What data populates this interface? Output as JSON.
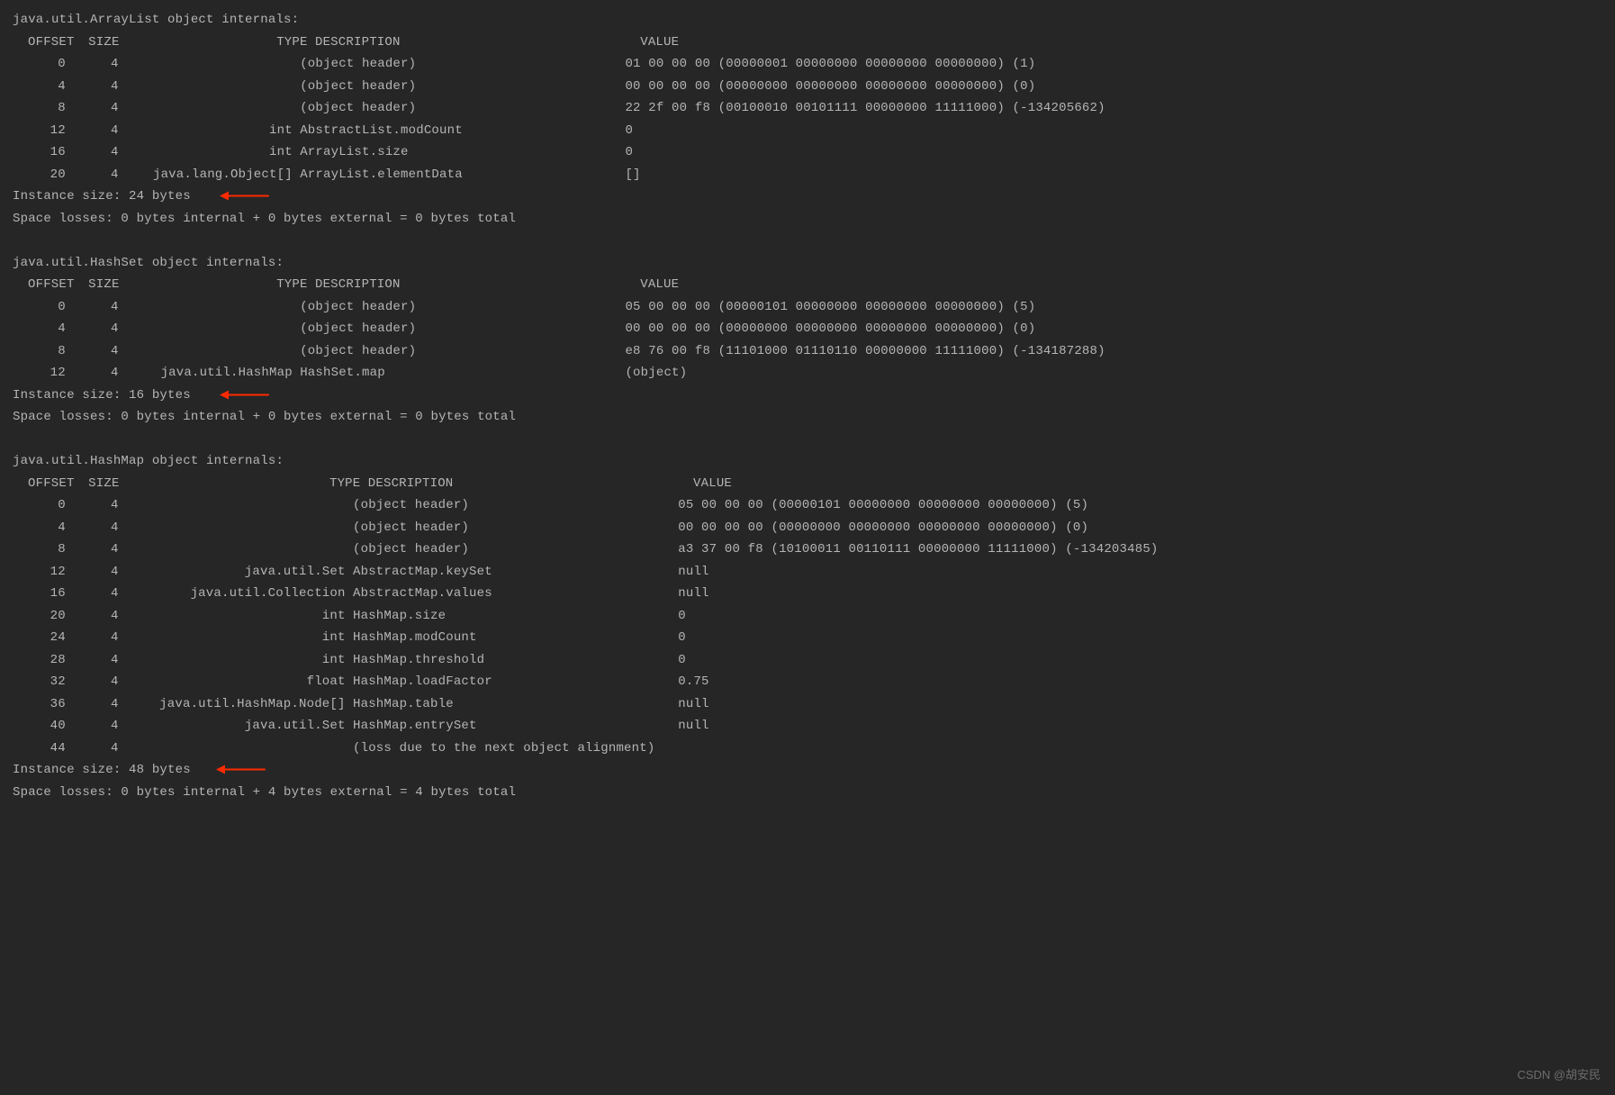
{
  "watermark": "CSDN @胡安民",
  "tables": [
    {
      "title": "java.util.ArrayList object internals:",
      "typeClass": "col-type-a",
      "descClass": "col-desc-a",
      "hdr": {
        "offset": "OFFSET",
        "size": "SIZE",
        "type": "TYPE",
        "desc": "DESCRIPTION",
        "val": "VALUE"
      },
      "rows": [
        {
          "offset": "0",
          "size": "4",
          "type": "",
          "desc": "(object header)",
          "val": "01 00 00 00 (00000001 00000000 00000000 00000000) (1)"
        },
        {
          "offset": "4",
          "size": "4",
          "type": "",
          "desc": "(object header)",
          "val": "00 00 00 00 (00000000 00000000 00000000 00000000) (0)"
        },
        {
          "offset": "8",
          "size": "4",
          "type": "",
          "desc": "(object header)",
          "val": "22 2f 00 f8 (00100010 00101111 00000000 11111000) (-134205662)"
        },
        {
          "offset": "12",
          "size": "4",
          "type": "int",
          "desc": "AbstractList.modCount",
          "val": "0"
        },
        {
          "offset": "16",
          "size": "4",
          "type": "int",
          "desc": "ArrayList.size",
          "val": "0"
        },
        {
          "offset": "20",
          "size": "4",
          "type": "java.lang.Object[]",
          "desc": "ArrayList.elementData",
          "val": "[]"
        }
      ],
      "instance": "Instance size: 24 bytes",
      "arrowLeft": 230,
      "losses": "Space losses: 0 bytes internal + 0 bytes external = 0 bytes total"
    },
    {
      "title": "java.util.HashSet object internals:",
      "typeClass": "col-type-b",
      "descClass": "col-desc-b",
      "hdr": {
        "offset": "OFFSET",
        "size": "SIZE",
        "type": "TYPE",
        "desc": "DESCRIPTION",
        "val": "VALUE"
      },
      "rows": [
        {
          "offset": "0",
          "size": "4",
          "type": "",
          "desc": "(object header)",
          "val": "05 00 00 00 (00000101 00000000 00000000 00000000) (5)"
        },
        {
          "offset": "4",
          "size": "4",
          "type": "",
          "desc": "(object header)",
          "val": "00 00 00 00 (00000000 00000000 00000000 00000000) (0)"
        },
        {
          "offset": "8",
          "size": "4",
          "type": "",
          "desc": "(object header)",
          "val": "e8 76 00 f8 (11101000 01110110 00000000 11111000) (-134187288)"
        },
        {
          "offset": "12",
          "size": "4",
          "type": "java.util.HashMap",
          "desc": "HashSet.map",
          "val": "(object)"
        }
      ],
      "instance": "Instance size: 16 bytes",
      "arrowLeft": 230,
      "losses": "Space losses: 0 bytes internal + 0 bytes external = 0 bytes total"
    },
    {
      "title": "java.util.HashMap object internals:",
      "typeClass": "col-type-c",
      "descClass": "col-desc-c",
      "hdr": {
        "offset": "OFFSET",
        "size": "SIZE",
        "type": "TYPE",
        "desc": "DESCRIPTION",
        "val": "VALUE"
      },
      "rows": [
        {
          "offset": "0",
          "size": "4",
          "type": "",
          "desc": "(object header)",
          "val": "05 00 00 00 (00000101 00000000 00000000 00000000) (5)"
        },
        {
          "offset": "4",
          "size": "4",
          "type": "",
          "desc": "(object header)",
          "val": "00 00 00 00 (00000000 00000000 00000000 00000000) (0)"
        },
        {
          "offset": "8",
          "size": "4",
          "type": "",
          "desc": "(object header)",
          "val": "a3 37 00 f8 (10100011 00110111 00000000 11111000) (-134203485)"
        },
        {
          "offset": "12",
          "size": "4",
          "type": "java.util.Set",
          "desc": "AbstractMap.keySet",
          "val": "null"
        },
        {
          "offset": "16",
          "size": "4",
          "type": "java.util.Collection",
          "desc": "AbstractMap.values",
          "val": "null"
        },
        {
          "offset": "20",
          "size": "4",
          "type": "int",
          "desc": "HashMap.size",
          "val": "0"
        },
        {
          "offset": "24",
          "size": "4",
          "type": "int",
          "desc": "HashMap.modCount",
          "val": "0"
        },
        {
          "offset": "28",
          "size": "4",
          "type": "int",
          "desc": "HashMap.threshold",
          "val": "0"
        },
        {
          "offset": "32",
          "size": "4",
          "type": "float",
          "desc": "HashMap.loadFactor",
          "val": "0.75"
        },
        {
          "offset": "36",
          "size": "4",
          "type": "java.util.HashMap.Node[]",
          "desc": "HashMap.table",
          "val": "null"
        },
        {
          "offset": "40",
          "size": "4",
          "type": "java.util.Set",
          "desc": "HashMap.entrySet",
          "val": "null"
        },
        {
          "offset": "44",
          "size": "4",
          "type": "",
          "desc": "(loss due to the next object alignment)",
          "val": ""
        }
      ],
      "instance": "Instance size: 48 bytes",
      "arrowLeft": 226,
      "losses": "Space losses: 0 bytes internal + 4 bytes external = 4 bytes total"
    }
  ]
}
